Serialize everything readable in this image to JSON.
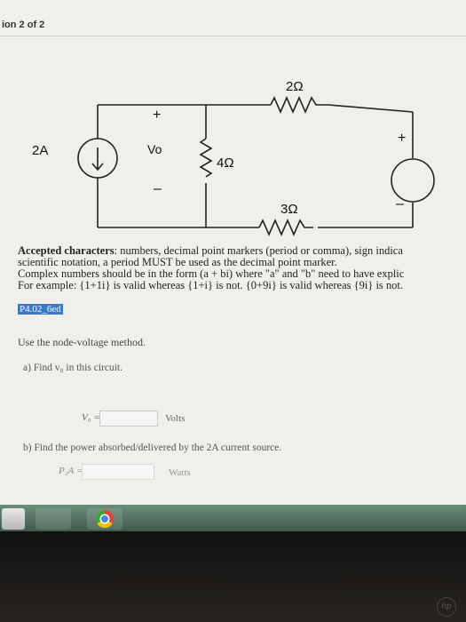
{
  "page": {
    "header_label": "ion 2 of 2"
  },
  "circuit": {
    "current_source": "2A",
    "vo_label": "Vo",
    "plus_sign": "+",
    "minus_sign": "–",
    "r1": "2Ω",
    "r2": "4Ω",
    "r3": "3Ω",
    "vsource_plus": "+",
    "vsource_minus": "–"
  },
  "info": {
    "line1_bold": "Accepted characters",
    "line1_rest": ": numbers, decimal point markers (period or comma), sign indica",
    "line2": "scientific notation, a period MUST be used as the decimal point marker.",
    "line3": "Complex numbers should be in the form (a + bi) where \"a\" and \"b\" need to have explic",
    "line4": "For example: {1+1i} is valid whereas {1+i} is not. {0+9i} is valid whereas {9i} is not."
  },
  "question": {
    "tag": "P4.02_6ed",
    "instruction": "Use the node-voltage method.",
    "part_a": "a) Find v₀ in this circuit.",
    "vo_field_label": "V₀ =",
    "vo_value": "",
    "vo_unit": "Volts",
    "part_b": "b) Find the power absorbed/delivered by the 2A current source.",
    "p_field_label": "P₂A =",
    "p_value": "",
    "p_unit": "Watts"
  },
  "colors": {
    "screen_bg": "#f0efec",
    "tag_bg": "#3b78c8",
    "taskbar": "#4f6e5e"
  }
}
